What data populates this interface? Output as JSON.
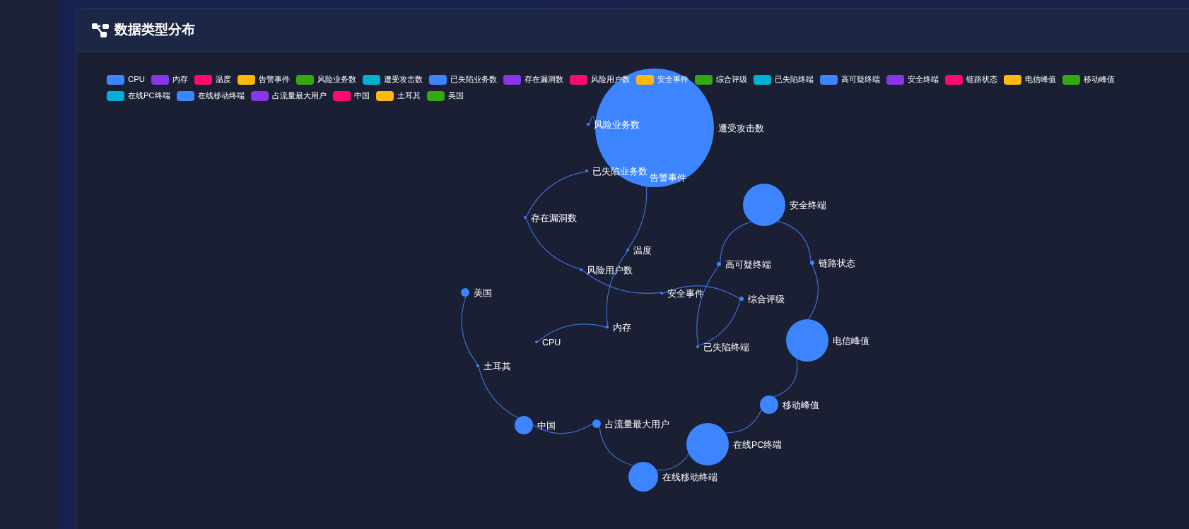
{
  "panel": {
    "title": "数据类型分布"
  },
  "legend": [
    {
      "label": "CPU",
      "color": "#3d85ff"
    },
    {
      "label": "内存",
      "color": "#8a36e8"
    },
    {
      "label": "温度",
      "color": "#ff0a6c"
    },
    {
      "label": "告警事件",
      "color": "#ffb60f"
    },
    {
      "label": "风险业务数",
      "color": "#34a80d"
    },
    {
      "label": "遭受攻击数",
      "color": "#03b0d1"
    },
    {
      "label": "已失陷业务数",
      "color": "#3d85ff"
    },
    {
      "label": "存在漏洞数",
      "color": "#8a36e8"
    },
    {
      "label": "风险用户数",
      "color": "#ff0a6c"
    },
    {
      "label": "安全事件",
      "color": "#ffb60f"
    },
    {
      "label": "综合评级",
      "color": "#34a80d"
    },
    {
      "label": "已失陷终端",
      "color": "#03b0d1"
    },
    {
      "label": "高可疑终端",
      "color": "#3d85ff"
    },
    {
      "label": "安全终端",
      "color": "#8a36e8"
    },
    {
      "label": "链路状态",
      "color": "#ff0a6c"
    },
    {
      "label": "电信峰值",
      "color": "#ffb60f"
    },
    {
      "label": "移动峰值",
      "color": "#34a80d"
    },
    {
      "label": "在线PC终端",
      "color": "#03b0d1"
    },
    {
      "label": "在线移动终端",
      "color": "#3d85ff"
    },
    {
      "label": "占流量最大用户",
      "color": "#8a36e8"
    },
    {
      "label": "中国",
      "color": "#ff0a6c"
    },
    {
      "label": "土耳其",
      "color": "#ffb60f"
    },
    {
      "label": "美国",
      "color": "#34a80d"
    }
  ],
  "graph": {
    "nodes": [
      {
        "label": "遭受攻击数",
        "kind": "huge"
      },
      {
        "label": "风险业务数",
        "kind": "point"
      },
      {
        "label": "已失陷业务数",
        "kind": "point"
      },
      {
        "label": "告警事件",
        "kind": "label"
      },
      {
        "label": "存在漏洞数",
        "kind": "point"
      },
      {
        "label": "温度",
        "kind": "point"
      },
      {
        "label": "风险用户数",
        "kind": "point"
      },
      {
        "label": "安全事件",
        "kind": "point"
      },
      {
        "label": "内存",
        "kind": "point"
      },
      {
        "label": "CPU",
        "kind": "point"
      },
      {
        "label": "安全终端",
        "kind": "large"
      },
      {
        "label": "高可疑终端",
        "kind": "dot"
      },
      {
        "label": "链路状态",
        "kind": "dot"
      },
      {
        "label": "综合评级",
        "kind": "dot"
      },
      {
        "label": "已失陷终端",
        "kind": "point"
      },
      {
        "label": "电信峰值",
        "kind": "large"
      },
      {
        "label": "移动峰值",
        "kind": "medium"
      },
      {
        "label": "在线PC终端",
        "kind": "large"
      },
      {
        "label": "在线移动终端",
        "kind": "mid"
      },
      {
        "label": "中国",
        "kind": "medium"
      },
      {
        "label": "占流量最大用户",
        "kind": "small"
      },
      {
        "label": "土耳其",
        "kind": "point"
      },
      {
        "label": "美国",
        "kind": "small"
      }
    ]
  }
}
